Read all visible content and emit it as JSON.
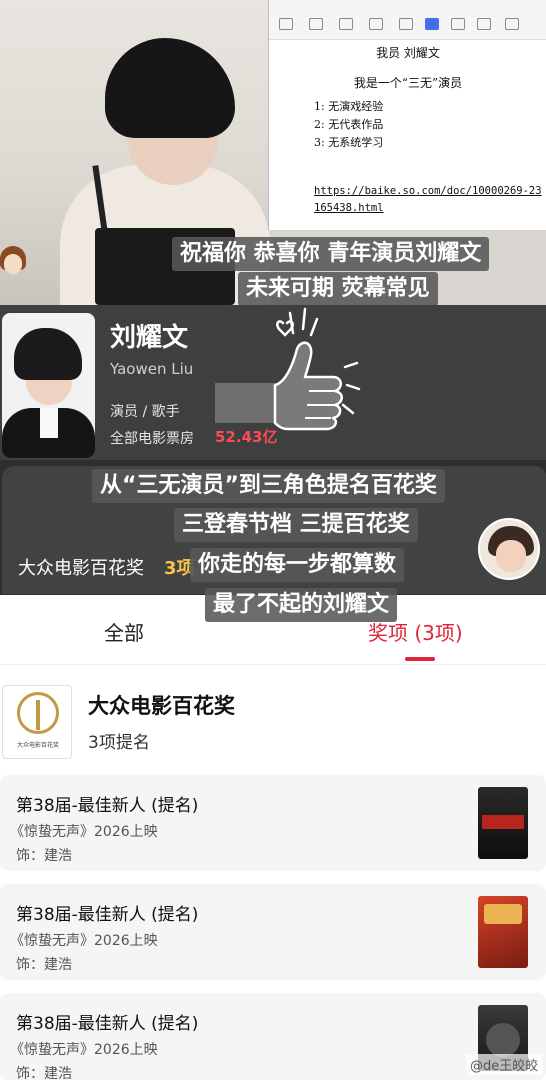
{
  "document": {
    "title": "我员 刘耀文",
    "subtitle": "我是一个“三无”演员",
    "items": [
      "1:  无演戏经验",
      "2:  无代表作品",
      "3:  无系统学习"
    ],
    "link": "https://baike.so.com/doc/10000269-23165438.html"
  },
  "captions": {
    "line1": "祝福你 恭喜你 青年演员刘耀文",
    "line2": "未来可期 荧幕常见",
    "line3": "从“三无演员”到三角色提名百花奖",
    "line4": "三登春节档 三提百花奖",
    "line5": "你走的每一步都算数",
    "line6": "最了不起的刘耀文"
  },
  "profile": {
    "name_cn": "刘耀文",
    "name_en": "Yaowen Liu",
    "roles": "演员 / 歌手",
    "box_office_label": "全部电影票房",
    "box_office_value": "52.43亿"
  },
  "award_strip": {
    "name": "大众电影百花奖",
    "count": "3项"
  },
  "tabs": {
    "all": "全部",
    "prizes": "奖项 (3项)"
  },
  "award": {
    "title": "大众电影百花奖",
    "subtitle": "3项提名",
    "logo_text": "大众电影百花奖"
  },
  "nominations": [
    {
      "title": "第38届-最佳新人 (提名)",
      "film": "《惊蛰无声》2026上映",
      "role": "饰：建浩"
    },
    {
      "title": "第38届-最佳新人 (提名)",
      "film": "《惊蛰无声》2026上映",
      "role": "饰：建浩"
    },
    {
      "title": "第38届-最佳新人 (提名)",
      "film": "《惊蛰无声》2026上映",
      "role": "饰：建浩"
    }
  ],
  "watermark": "@de王皎皎",
  "colors": {
    "accent_red": "#e0253a",
    "box_office_red": "#ff4b55",
    "gold": "#f6c24a",
    "card_dark": "#3e3f3f"
  }
}
